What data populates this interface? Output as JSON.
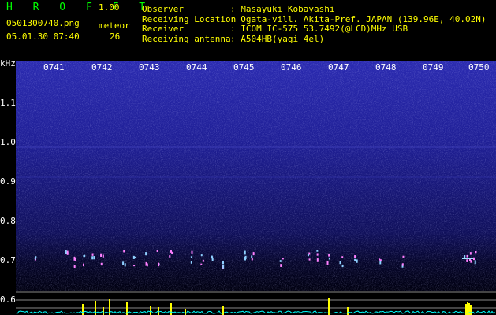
{
  "app": {
    "name": "H R O F F T",
    "version": "1.00"
  },
  "file": {
    "filename": "0501300740.png",
    "datetime": "05.01.30 07:40"
  },
  "meteor": {
    "label": "meteor",
    "count": "26"
  },
  "info": {
    "observer_label": "Observer",
    "observer_value": ": Masayuki Kobayashi",
    "location_label": "Receiving Location",
    "location_value": ": Ogata-vill. Akita-Pref. JAPAN (139.96E, 40.02N)",
    "receiver_label": "Receiver",
    "receiver_value": ": ICOM IC-575 53.7492(@LCD)MHz USB",
    "antenna_label": "Receiving antenna",
    "antenna_value": ": A504HB(yagi 4el)"
  },
  "axis": {
    "unit": "kHz",
    "y_ticks": [
      "1.1",
      "1.0",
      "0.9",
      "0.8",
      "0.7",
      "0.6"
    ],
    "x_ticks": [
      "0741",
      "0742",
      "0743",
      "0744",
      "0745",
      "0746",
      "0747",
      "0748",
      "0749",
      "0750"
    ]
  },
  "colors": {
    "background": "#000000",
    "brand": "#00ff00",
    "accent": "#ffff00",
    "spectrum": "#1a1a8c",
    "echo": "#ffff00",
    "noise": "#00ffff"
  }
}
